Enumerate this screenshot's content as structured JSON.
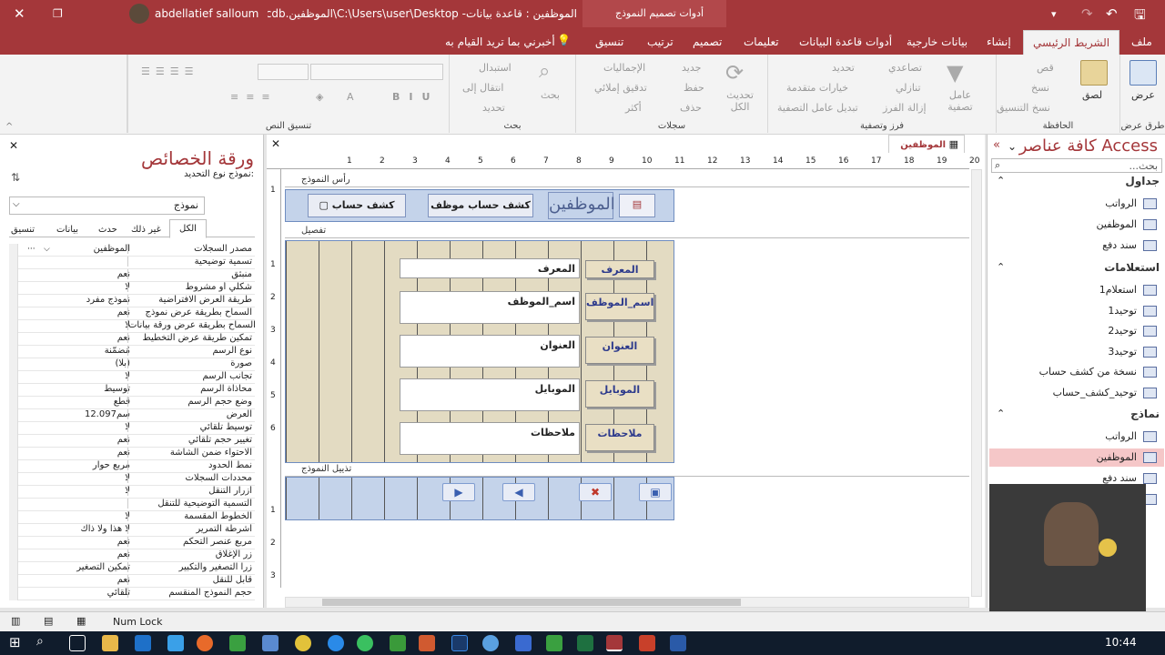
{
  "titlebar": {
    "user": "abdellatief salloum",
    "title": "الموظفين : قاعدة بيانات- C:\\Users\\user\\Desktop\\الموظفين.accdb (تن...",
    "context_tab": "أدوات تصميم النموذج"
  },
  "tabs": [
    "ملف",
    "الشريط الرئيسي",
    "إنشاء",
    "بيانات خارجية",
    "أدوات قاعدة البيانات",
    "تعليمات",
    "تصميم",
    "ترتيب",
    "تنسيق"
  ],
  "tell_me": "أخبرني بما تريد القيام به",
  "ribbon": {
    "views": {
      "label": "طرق عرض",
      "view": "عرض"
    },
    "clipboard": {
      "label": "الحافظة",
      "paste": "لصق",
      "cut": "قص",
      "copy": "نسخ",
      "format_painter": "نسخ التنسيق"
    },
    "sort_filter": {
      "label": "فرز وتصفية",
      "filter": "عامل تصفية",
      "ascending": "تصاعدي",
      "descending": "تنازلي",
      "remove_sort": "إزالة الفرز",
      "selection": "تحديد",
      "advanced": "خيارات متقدمة",
      "toggle_filter": "تبديل عامل التصفية"
    },
    "records": {
      "label": "سجلات",
      "refresh": "تحديث الكل",
      "new": "جديد",
      "save": "حفظ",
      "delete": "حذف",
      "totals": "الإجماليات",
      "spelling": "تدقيق إملائي",
      "more": "أكثر"
    },
    "find": {
      "label": "بحث",
      "find": "بحث",
      "replace": "استبدال",
      "goto": "انتقال إلى",
      "select": "تحديد"
    },
    "text_format": {
      "label": "تنسيق النص"
    }
  },
  "property_sheet": {
    "title": "ورقة الخصائص",
    "selection_type_label": "نوع التحديد:",
    "selection_type": "نموذج",
    "selected_object": "نموذج",
    "tabs": [
      "تنسيق",
      "بيانات",
      "حدث",
      "غير ذلك",
      "الكل"
    ],
    "rows": [
      {
        "name": "مصدر السجلات",
        "value": "الموظفين"
      },
      {
        "name": "تسمية توضيحية",
        "value": ""
      },
      {
        "name": "منبثق",
        "value": "نعم"
      },
      {
        "name": "شكلي أو مشروط",
        "value": "لا"
      },
      {
        "name": "طريقة العرض الافتراضية",
        "value": "نموذج مفرد"
      },
      {
        "name": "السماح بطريقة عرض نموذج",
        "value": "نعم"
      },
      {
        "name": "السماح بطريقة عرض ورقة بيانات",
        "value": "لا"
      },
      {
        "name": "تمكين طريقة عرض التخطيط",
        "value": "نعم"
      },
      {
        "name": "نوع الرسم",
        "value": "مُضمّنة"
      },
      {
        "name": "صورة",
        "value": "(بلا)"
      },
      {
        "name": "تجانب الرسم",
        "value": "لا"
      },
      {
        "name": "محاذاة الرسم",
        "value": "توسيط"
      },
      {
        "name": "وضع حجم الرسم",
        "value": "قطع"
      },
      {
        "name": "العرض",
        "value": "12.097سم"
      },
      {
        "name": "توسيط تلقائي",
        "value": "لا"
      },
      {
        "name": "تغيير حجم تلقائي",
        "value": "نعم"
      },
      {
        "name": "الاحتواء ضمن الشاشة",
        "value": "نعم"
      },
      {
        "name": "نمط الحدود",
        "value": "مربع حوار"
      },
      {
        "name": "محددات السجلات",
        "value": "لا"
      },
      {
        "name": "أزرار التنقل",
        "value": "لا"
      },
      {
        "name": "التسمية التوضيحية للتنقل",
        "value": ""
      },
      {
        "name": "الخطوط المقسمة",
        "value": "لا"
      },
      {
        "name": "أشرطة التمرير",
        "value": "لا هذا ولا ذاك"
      },
      {
        "name": "مربع عنصر التحكم",
        "value": "نعم"
      },
      {
        "name": "زر الإغلاق",
        "value": "نعم"
      },
      {
        "name": "زرا التصغير والتكبير",
        "value": "تمكين التصغير"
      },
      {
        "name": "قابل للنقل",
        "value": "نعم"
      },
      {
        "name": "حجم النموذج المنقسم",
        "value": "تلقائي"
      }
    ]
  },
  "document": {
    "tab_title": "الموظفين",
    "ruler": [
      "1",
      "2",
      "3",
      "4",
      "5",
      "6",
      "7",
      "8",
      "9",
      "10",
      "11",
      "12",
      "13",
      "14",
      "15",
      "16",
      "17",
      "18",
      "19",
      "20",
      "21"
    ],
    "vruler": [
      "1",
      "1",
      "2",
      "3",
      "4",
      "5",
      "6",
      "1",
      "2",
      "3"
    ],
    "sections": {
      "header": "رأس النموذج",
      "detail": "تفصيل",
      "footer": "تذييل النموذج"
    },
    "header": {
      "title": "الموظفين",
      "btn1": "كشف حساب موظف",
      "btn2": "كشف حساب"
    },
    "fields": [
      {
        "label": "المعرف",
        "value": "المعرف"
      },
      {
        "label": "اسم_الموظف",
        "value": "اسم_الموظف"
      },
      {
        "label": "العنوان",
        "value": "العنوان"
      },
      {
        "label": "الموبايل",
        "value": "الموبايل"
      },
      {
        "label": "ملاحظات",
        "value": "ملاحظات"
      }
    ],
    "footer_buttons": [
      "▶",
      "◀",
      "✖",
      "▣"
    ]
  },
  "nav": {
    "title": "كافة عناصر Access",
    "search_placeholder": "بحث...",
    "groups": [
      {
        "name": "جداول",
        "items": [
          "الرواتب",
          "الموظفين",
          "سند دفع"
        ]
      },
      {
        "name": "استعلامات",
        "items": [
          "استعلام1",
          "توحيد1",
          "توحيد2",
          "توحيد3",
          "نسخة من كشف حساب",
          "توحيد_كشف_حساب"
        ]
      },
      {
        "name": "نماذج",
        "items": [
          "الرواتب",
          "الموظفين",
          "سند دفع",
          "كشف حساب"
        ]
      }
    ],
    "selected": "الموظفين"
  },
  "status": {
    "num_lock": "Num Lock",
    "clock": "10:44"
  },
  "colors": {
    "accent": "#a4373a",
    "form_fill": "#c4d3ea",
    "grid_fill": "#e3dbc2"
  }
}
